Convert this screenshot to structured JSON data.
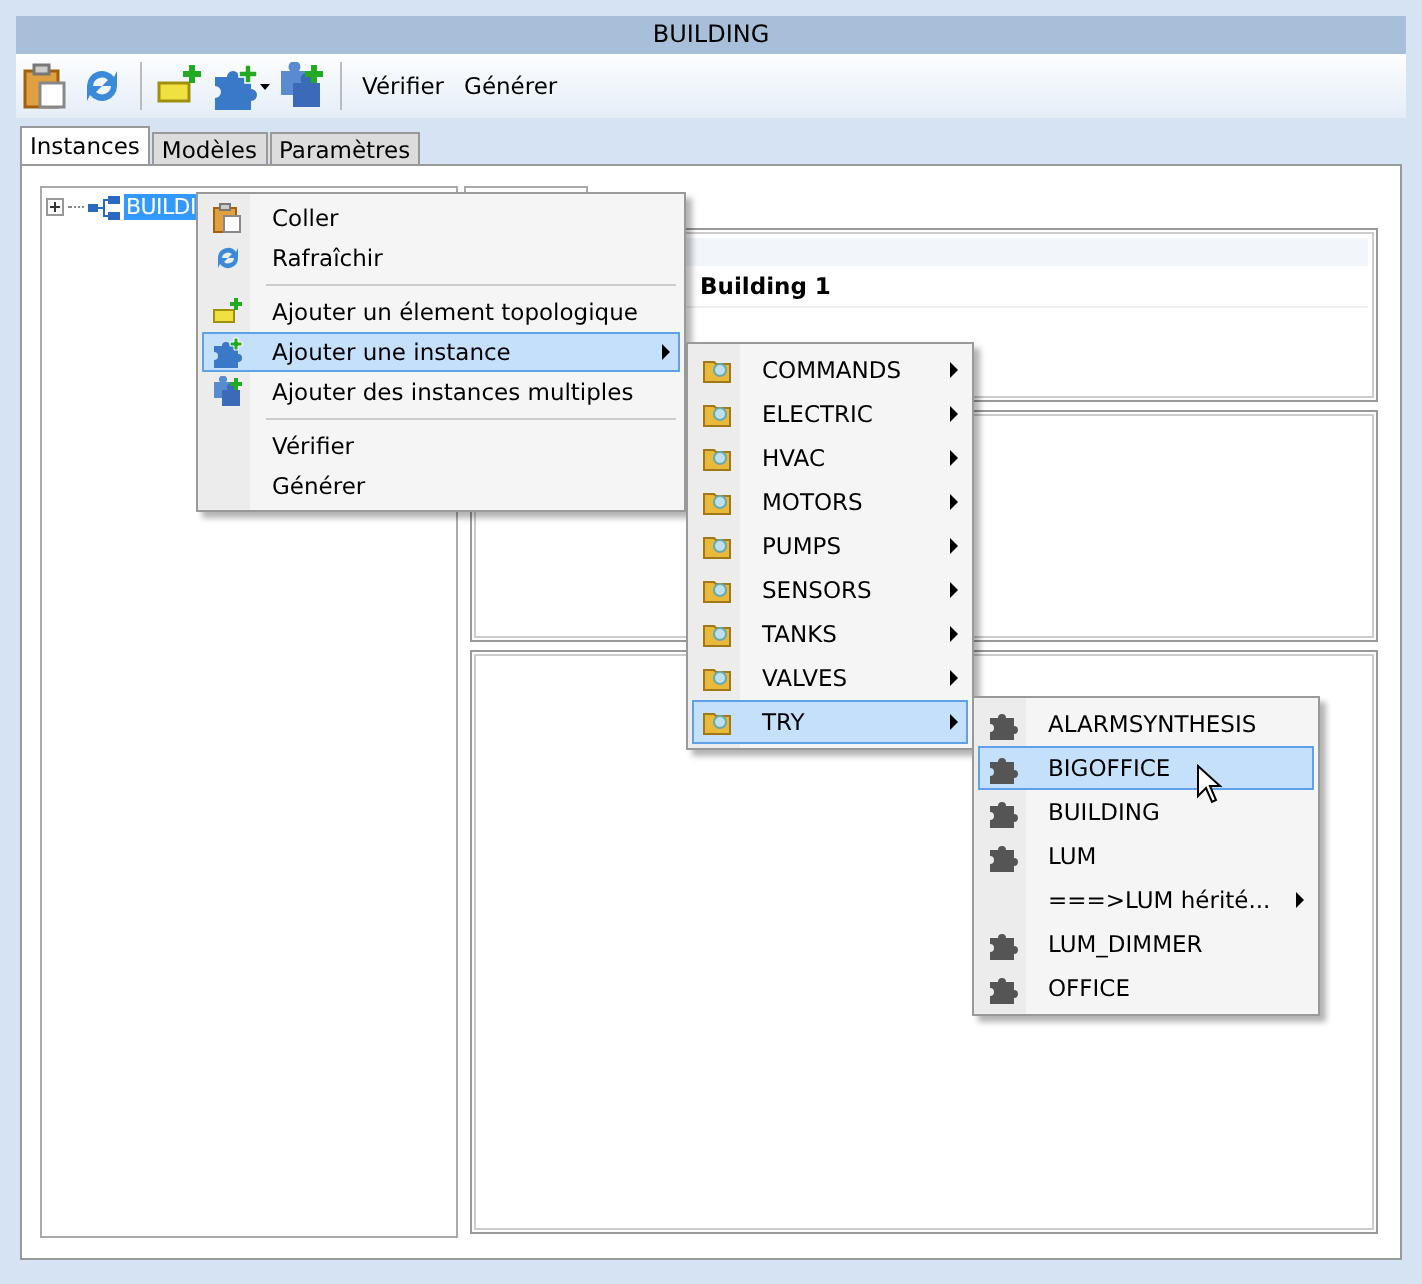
{
  "window": {
    "title": "BUILDING"
  },
  "toolbar": {
    "buttons": [
      "Vérifier",
      "Générer"
    ]
  },
  "tabs": [
    {
      "label": "Instances",
      "selected": true
    },
    {
      "label": "Modèles",
      "selected": false
    },
    {
      "label": "Paramètres",
      "selected": false
    }
  ],
  "tree": {
    "items": [
      {
        "label": "BUILDI",
        "selected": true,
        "expanded": false
      }
    ]
  },
  "details": {
    "name": "Building 1"
  },
  "context_menu": {
    "items": [
      {
        "kind": "item",
        "label": "Coller",
        "selected": false,
        "has_submenu": false
      },
      {
        "kind": "item",
        "label": "Rafraîchir",
        "selected": false,
        "has_submenu": false
      },
      {
        "kind": "separator"
      },
      {
        "kind": "item",
        "label": "Ajouter un élement topologique",
        "selected": false,
        "has_submenu": false
      },
      {
        "kind": "item",
        "label": "Ajouter une instance",
        "selected": true,
        "has_submenu": true
      },
      {
        "kind": "item",
        "label": "Ajouter des instances multiples",
        "selected": false,
        "has_submenu": false
      },
      {
        "kind": "separator"
      },
      {
        "kind": "item",
        "label": "Vérifier",
        "selected": false,
        "has_submenu": false
      },
      {
        "kind": "item",
        "label": "Générer",
        "selected": false,
        "has_submenu": false
      }
    ]
  },
  "category_menu": {
    "items": [
      {
        "label": "COMMANDS",
        "selected": false
      },
      {
        "label": "ELECTRIC",
        "selected": false
      },
      {
        "label": "HVAC",
        "selected": false
      },
      {
        "label": "MOTORS",
        "selected": false
      },
      {
        "label": "PUMPS",
        "selected": false
      },
      {
        "label": "SENSORS",
        "selected": false
      },
      {
        "label": "TANKS",
        "selected": false
      },
      {
        "label": "VALVES",
        "selected": false
      },
      {
        "label": "TRY",
        "selected": true
      }
    ]
  },
  "model_menu": {
    "items": [
      {
        "kind": "model",
        "label": "ALARMSYNTHESIS",
        "selected": false
      },
      {
        "kind": "model",
        "label": "BIGOFFICE",
        "selected": true
      },
      {
        "kind": "model",
        "label": "BUILDING",
        "selected": false
      },
      {
        "kind": "model",
        "label": "LUM",
        "selected": false
      },
      {
        "kind": "group",
        "label": "===>LUM hérité...",
        "selected": false
      },
      {
        "kind": "model",
        "label": "LUM_DIMMER",
        "selected": false
      },
      {
        "kind": "model",
        "label": "OFFICE",
        "selected": false
      }
    ]
  }
}
